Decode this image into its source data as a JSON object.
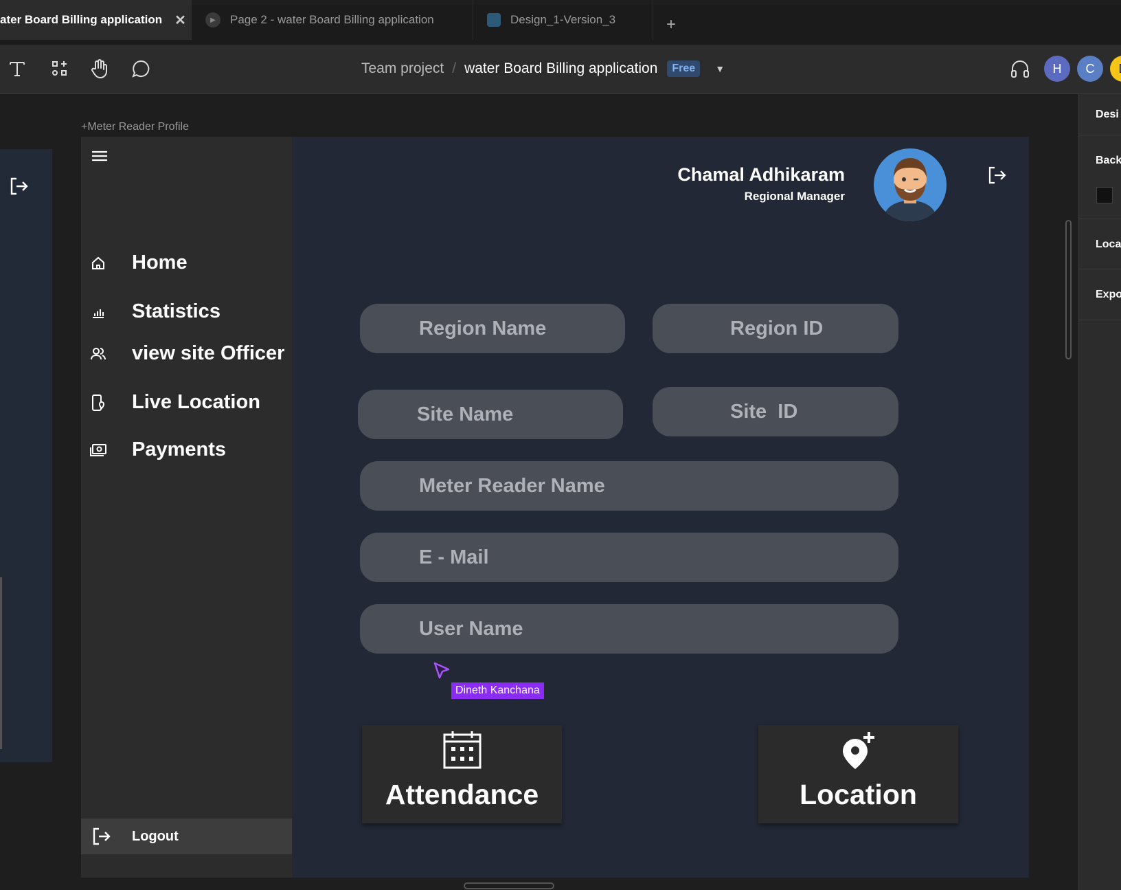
{
  "tabs": [
    {
      "label": "ater Board Billing application",
      "active": true,
      "close": "✕"
    },
    {
      "label": "Page 2 - water Board Billing application",
      "active": false
    },
    {
      "label": "Design_1-Version_3",
      "active": false
    }
  ],
  "new_tab": "+",
  "breadcrumb": {
    "team": "Team project",
    "separator": "/",
    "file": "water Board Billing application",
    "badge": "Free"
  },
  "collaborators": [
    {
      "initial": "H",
      "color": "#5c6bc0"
    },
    {
      "initial": "C",
      "color": "#5b7fc4"
    },
    {
      "initial": "D",
      "color": "#f5c518"
    }
  ],
  "right_panel": {
    "items": [
      "Desi",
      "Back",
      "Loca",
      "Expo"
    ]
  },
  "frame_label": "+Meter Reader Profile",
  "profile": {
    "name": "Chamal Adhikaram",
    "role": "Regional Manager"
  },
  "nav": {
    "items": [
      {
        "label": "Home",
        "icon": "home-icon"
      },
      {
        "label": "Statistics",
        "icon": "bar-chart-icon"
      },
      {
        "label": "view site Officer",
        "icon": "users-icon"
      },
      {
        "label": "Live Location",
        "icon": "phone-location-icon"
      },
      {
        "label": "Payments",
        "icon": "money-icon"
      }
    ],
    "logout": "Logout"
  },
  "form": {
    "region_name": "Region Name",
    "region_id": "Region ID",
    "site_name": "Site Name",
    "site_id": "Site  ID",
    "meter_reader_name": "Meter Reader Name",
    "email": "E - Mail",
    "user_name": "User Name"
  },
  "cursor_user": "Dineth Kanchana",
  "cards": {
    "attendance": "Attendance",
    "location": "Location"
  },
  "colors": {
    "frame_bg": "#232836",
    "sidebar_bg": "#2c2c2c",
    "field_bg": "#4a4e57",
    "cursor": "#8b2cf5",
    "free_badge": "#2f4a6e"
  }
}
